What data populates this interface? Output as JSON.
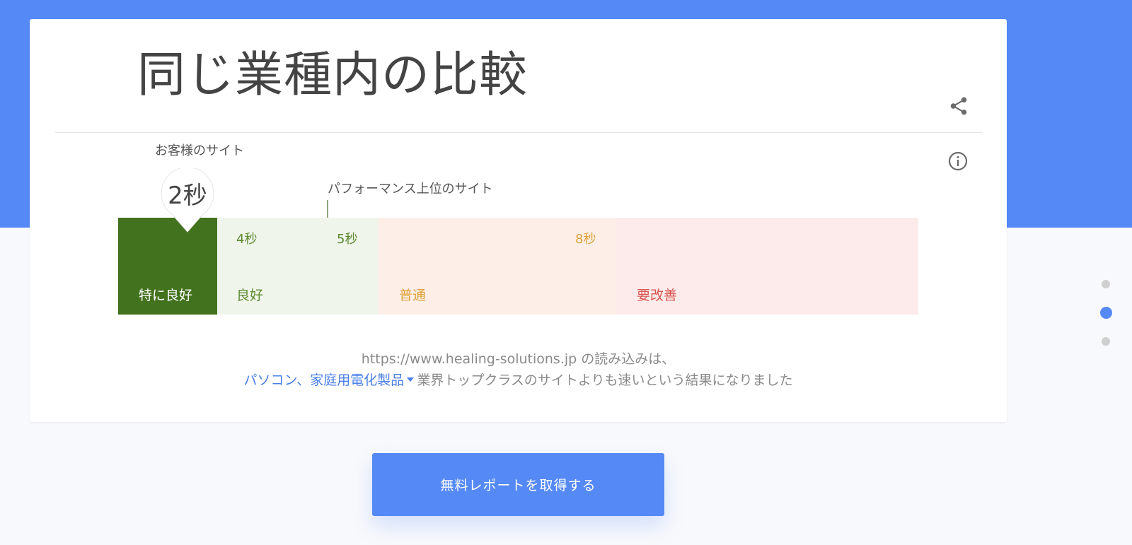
{
  "title": "同じ業種内の比較",
  "icons": {
    "share": "share-icon",
    "info": "info-icon"
  },
  "comparison": {
    "customer_label": "お客様のサイト",
    "customer_value": "2秒",
    "top_sites_label": "パフォーマンス上位のサイト",
    "ticks": [
      "4秒",
      "5秒",
      "8秒"
    ],
    "segments": [
      {
        "label": "特に良好",
        "color": "#43721e"
      },
      {
        "label": "良好",
        "color": "#f0f5ec"
      },
      {
        "label": "普通",
        "color": "#fdefe8"
      },
      {
        "label": "要改善",
        "color": "#fcebea"
      }
    ]
  },
  "result": {
    "line1_text": "https://www.healing-solutions.jp の読み込みは、",
    "industry": "パソコン、家庭用電化製品",
    "line2_text": "業界トップクラスのサイトよりも速いという結果になりました"
  },
  "cta": {
    "label": "無料レポートを取得する"
  },
  "colors": {
    "accent": "#5589f6",
    "excellent": "#43721e",
    "good_text": "#5d8a2e",
    "average_text": "#e0a23a",
    "poor_text": "#d9534f"
  },
  "pagination": {
    "count": 3,
    "active_index": 1
  }
}
